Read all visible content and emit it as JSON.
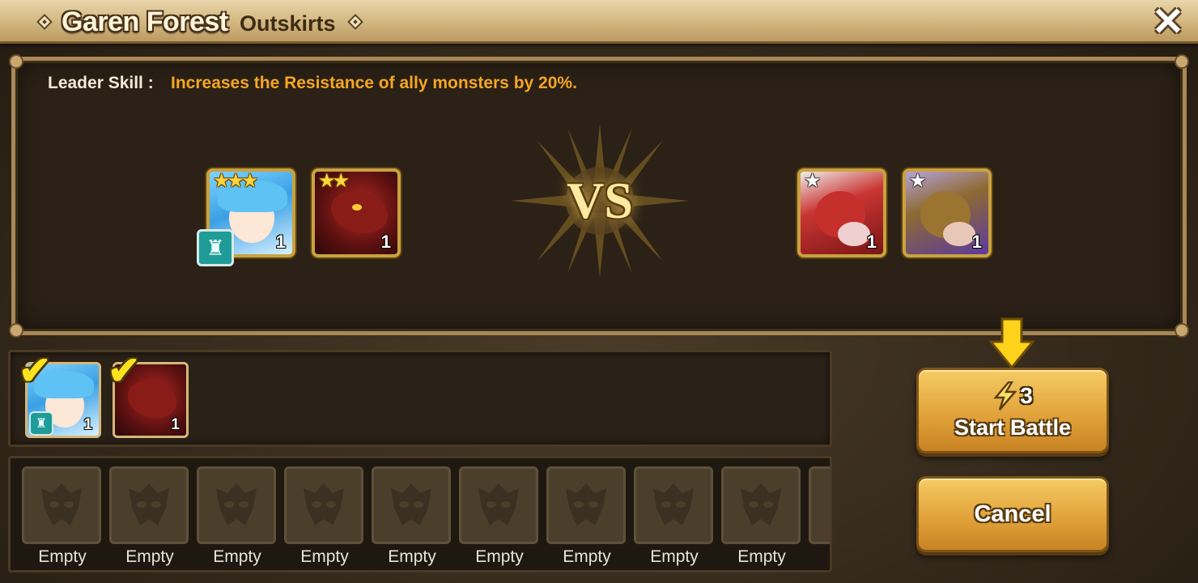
{
  "header": {
    "title": "Garen Forest",
    "subtitle": "Outskirts"
  },
  "leader_skill": {
    "label": "Leader Skill :",
    "text": "Increases the Resistance of ally monsters by 20%."
  },
  "vs_label": "VS",
  "ally_team": [
    {
      "name_icon": "blue-haired-mermaid-monster-portrait",
      "stars": "★★★",
      "level": "1",
      "leader": true
    },
    {
      "name_icon": "red-hellhound-monster-portrait",
      "stars": "★★",
      "level": "1",
      "leader": false
    }
  ],
  "enemy_team": [
    {
      "name_icon": "red-boar-monster-portrait",
      "stars": "★",
      "level": "1"
    },
    {
      "name_icon": "gold-boar-monster-portrait",
      "stars": "★",
      "level": "1"
    }
  ],
  "selected": [
    {
      "name_icon": "blue-haired-mermaid-monster-portrait",
      "level": "1"
    },
    {
      "name_icon": "red-hellhound-monster-portrait",
      "level": "1"
    }
  ],
  "empty_slots": [
    "Empty",
    "Empty",
    "Empty",
    "Empty",
    "Empty",
    "Empty",
    "Empty",
    "Empty",
    "Empty"
  ],
  "buttons": {
    "start_battle": "Start Battle",
    "energy_cost": "3",
    "cancel": "Cancel"
  },
  "colors": {
    "accent_gold": "#f5a623",
    "button_gold": "#e2a33b",
    "leader_badge": "#1f9c98"
  }
}
